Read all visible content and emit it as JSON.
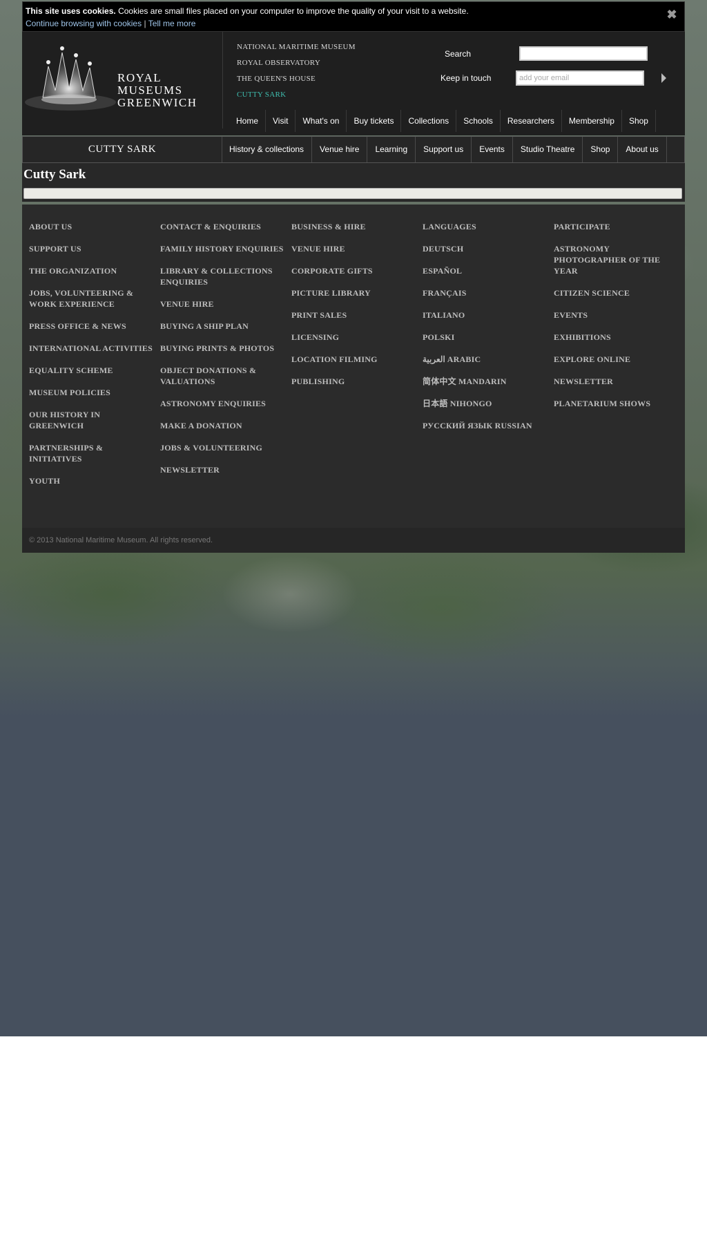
{
  "cookie": {
    "bold": "This site uses cookies.",
    "text": "Cookies are small files placed on your computer to improve the quality of your visit to a website.",
    "continue_link": "Continue browsing with cookies",
    "separator": "|",
    "more_link": "Tell me more",
    "close_glyph": "✖"
  },
  "logo": {
    "line1": "ROYAL",
    "line2": "MUSEUMS",
    "line3": "GREENWICH"
  },
  "sites": [
    "National Maritime Museum",
    "Royal Observatory",
    "The Queen's House",
    "Cutty Sark"
  ],
  "search": {
    "label": "Search",
    "placeholder": ""
  },
  "keep_in_touch": {
    "label": "Keep in touch",
    "placeholder": "add your email"
  },
  "main_nav": [
    "Home",
    "Visit",
    "What's on",
    "Buy tickets",
    "Collections",
    "Schools",
    "Researchers",
    "Membership",
    "Shop"
  ],
  "sub_title": "CUTTY SARK",
  "sub_nav": [
    "History & collections",
    "Venue hire",
    "Learning",
    "Support us",
    "Events",
    "Studio Theatre",
    "Shop",
    "About us"
  ],
  "page_title": "Cutty Sark",
  "footer_columns": [
    [
      "About us",
      "Support us",
      "The organization",
      "Jobs, volunteering & work experience",
      "Press office & news",
      "International activities",
      "Equality scheme",
      "Museum policies",
      "Our history in Greenwich",
      "Partnerships & initiatives",
      "Youth"
    ],
    [
      "Contact & enquiries",
      "Family history enquiries",
      "Library & collections enquiries",
      "Venue hire",
      "Buying a ship plan",
      "Buying prints & photos",
      "Object donations & valuations",
      "Astronomy enquiries",
      "Make a donation",
      "Jobs & volunteering",
      "Newsletter"
    ],
    [
      "Business & hire",
      "Venue hire",
      "Corporate gifts",
      "Picture library",
      "Print sales",
      "Licensing",
      "Location filming",
      "Publishing"
    ],
    [
      "Languages",
      "Deutsch",
      "Español",
      "Français",
      "Italiano",
      "Polski",
      "العربية Arabic",
      "简体中文 Mandarin",
      "日本語 Nihongo",
      "Русский язык Russian"
    ],
    [
      "Participate",
      "Astronomy photographer of the year",
      "Citizen science",
      "Events",
      "Exhibitions",
      "Explore online",
      "Newsletter",
      "Planetarium shows"
    ]
  ],
  "copyright": "© 2013 National Maritime Museum. All rights reserved.",
  "colors": {
    "active_site": "#3fbfb0",
    "header_bg": "#1f1f1f",
    "footer_bg": "#2b2b2b"
  }
}
